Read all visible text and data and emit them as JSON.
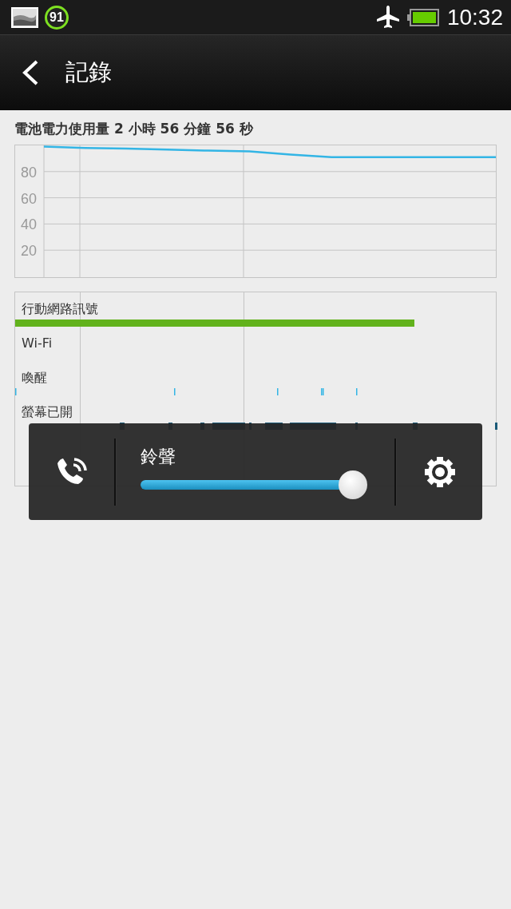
{
  "status_bar": {
    "badge": "91",
    "time": "10:32"
  },
  "header": {
    "title": "記錄"
  },
  "usage": {
    "text": "電池電力使用量 **2** 小時 **56** 分鐘 **56** 秒",
    "chart_data": {
      "type": "line",
      "grid": true,
      "ylim": [
        0,
        100
      ],
      "yticks": [
        {
          "value": 20,
          "label": "20"
        },
        {
          "value": 40,
          "label": "40"
        },
        {
          "value": 60,
          "label": "60"
        },
        {
          "value": 80,
          "label": "80"
        }
      ],
      "categories": [
        null,
        null,
        null,
        null,
        null,
        null,
        null,
        null,
        null,
        null,
        null,
        null
      ],
      "series": [
        {
          "color": "#33b5e5",
          "values": [
            99,
            98,
            97.5,
            96.8,
            96,
            95.5,
            93,
            91,
            91,
            91,
            91,
            91
          ]
        }
      ]
    }
  },
  "timeline": {
    "rows": [
      {
        "label": "行動網路訊號",
        "kind": "bar"
      },
      {
        "label": "Wi-Fi",
        "kind": "none"
      },
      {
        "label": "喚醒",
        "kind": "ticks"
      },
      {
        "label": "螢幕已開",
        "kind": "marks"
      }
    ]
  },
  "volume": {
    "title": "鈴聲",
    "level": 0.945
  }
}
